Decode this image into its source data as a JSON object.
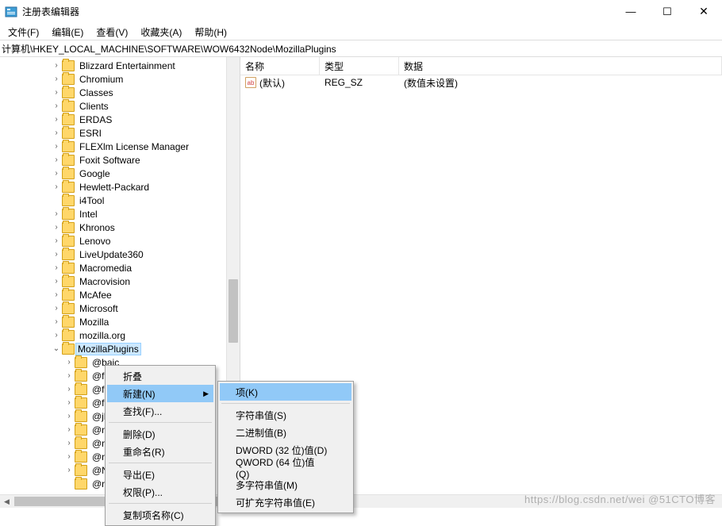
{
  "window": {
    "title": "注册表编辑器",
    "min": "—",
    "max": "☐",
    "close": "✕"
  },
  "menu": {
    "file": "文件(F)",
    "edit": "编辑(E)",
    "view": "查看(V)",
    "fav": "收藏夹(A)",
    "help": "帮助(H)"
  },
  "address": "计算机\\HKEY_LOCAL_MACHINE\\SOFTWARE\\WOW6432Node\\MozillaPlugins",
  "tree": [
    {
      "indent": 64,
      "twisty": ">",
      "label": "Blizzard Entertainment"
    },
    {
      "indent": 64,
      "twisty": ">",
      "label": "Chromium"
    },
    {
      "indent": 64,
      "twisty": ">",
      "label": "Classes"
    },
    {
      "indent": 64,
      "twisty": ">",
      "label": "Clients"
    },
    {
      "indent": 64,
      "twisty": ">",
      "label": "ERDAS"
    },
    {
      "indent": 64,
      "twisty": ">",
      "label": "ESRI"
    },
    {
      "indent": 64,
      "twisty": ">",
      "label": "FLEXlm License Manager"
    },
    {
      "indent": 64,
      "twisty": ">",
      "label": "Foxit Software"
    },
    {
      "indent": 64,
      "twisty": ">",
      "label": "Google"
    },
    {
      "indent": 64,
      "twisty": ">",
      "label": "Hewlett-Packard"
    },
    {
      "indent": 64,
      "twisty": "",
      "label": "i4Tool"
    },
    {
      "indent": 64,
      "twisty": ">",
      "label": "Intel"
    },
    {
      "indent": 64,
      "twisty": ">",
      "label": "Khronos"
    },
    {
      "indent": 64,
      "twisty": ">",
      "label": "Lenovo"
    },
    {
      "indent": 64,
      "twisty": ">",
      "label": "LiveUpdate360"
    },
    {
      "indent": 64,
      "twisty": ">",
      "label": "Macromedia"
    },
    {
      "indent": 64,
      "twisty": ">",
      "label": "Macrovision"
    },
    {
      "indent": 64,
      "twisty": ">",
      "label": "McAfee"
    },
    {
      "indent": 64,
      "twisty": ">",
      "label": "Microsoft"
    },
    {
      "indent": 64,
      "twisty": ">",
      "label": "Mozilla"
    },
    {
      "indent": 64,
      "twisty": ">",
      "label": "mozilla.org"
    },
    {
      "indent": 64,
      "twisty": "v",
      "label": "MozillaPlugins",
      "selected": true
    },
    {
      "indent": 80,
      "twisty": ">",
      "label": "@baic"
    },
    {
      "indent": 80,
      "twisty": ">",
      "label": "@foxi"
    },
    {
      "indent": 80,
      "twisty": ">",
      "label": "@foxi"
    },
    {
      "indent": 80,
      "twisty": ">",
      "label": "@foxi"
    },
    {
      "indent": 80,
      "twisty": ">",
      "label": "@jlgp"
    },
    {
      "indent": 80,
      "twisty": ">",
      "label": "@micr"
    },
    {
      "indent": 80,
      "twisty": ">",
      "label": "@micr"
    },
    {
      "indent": 80,
      "twisty": ">",
      "label": "@npD"
    },
    {
      "indent": 80,
      "twisty": ">",
      "label": "@NPFi..........."
    },
    {
      "indent": 80,
      "twisty": "",
      "label": "@nprt"
    }
  ],
  "list": {
    "headers": {
      "name": "名称",
      "type": "类型",
      "data": "数据"
    },
    "rows": [
      {
        "icon": "ab",
        "name": "(默认)",
        "type": "REG_SZ",
        "data": "(数值未设置)"
      }
    ]
  },
  "ctx1": {
    "collapse": "折叠",
    "new": "新建(N)",
    "find": "查找(F)...",
    "delete": "删除(D)",
    "rename": "重命名(R)",
    "export": "导出(E)",
    "perm": "权限(P)...",
    "copykey": "复制项名称(C)"
  },
  "ctx2": {
    "key": "项(K)",
    "string": "字符串值(S)",
    "binary": "二进制值(B)",
    "dword": "DWORD (32 位)值(D)",
    "qword": "QWORD (64 位)值(Q)",
    "multi": "多字符串值(M)",
    "expand": "可扩充字符串值(E)"
  },
  "watermark": "https://blog.csdn.net/wei @51CTO博客"
}
